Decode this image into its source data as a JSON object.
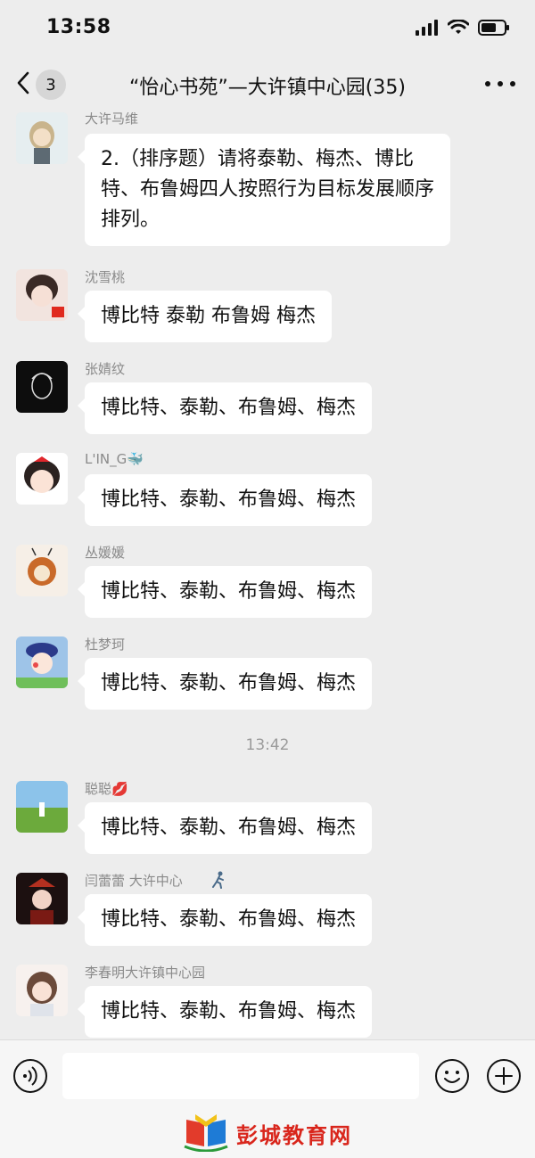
{
  "status_bar": {
    "time": "13:58",
    "icons": [
      "signal-icon",
      "wifi-icon",
      "battery-icon"
    ]
  },
  "nav": {
    "back_badge": "3",
    "title": "“怡心书苑”—大许镇中心园(35)"
  },
  "messages": [
    {
      "sender": "大许马维",
      "text": "2.（排序题）请将泰勒、梅杰、博比特、布鲁姆四人按照行为目标发展顺序排列。"
    },
    {
      "sender": "沈雪桃",
      "text": "博比特 泰勒 布鲁姆 梅杰"
    },
    {
      "sender": "张婧纹",
      "text": "博比特、泰勒、布鲁姆、梅杰"
    },
    {
      "sender": "L'IN_G🐳",
      "text": "博比特、泰勒、布鲁姆、梅杰"
    },
    {
      "sender": "丛媛媛",
      "text": "博比特、泰勒、布鲁姆、梅杰"
    },
    {
      "sender": "杜梦珂",
      "text": "博比特、泰勒、布鲁姆、梅杰"
    },
    {
      "sender": "聪聪💋",
      "text": "博比特、泰勒、布鲁姆、梅杰"
    },
    {
      "sender": "闫蕾蕾 大许中心",
      "text": "博比特、泰勒、布鲁姆、梅杰"
    },
    {
      "sender": "李春明大许镇中心园",
      "text": "博比特、泰勒、布鲁姆、梅杰"
    }
  ],
  "time_divider": "13:42",
  "input_bar": {
    "watermark": "彭城教育网"
  },
  "colors": {
    "background": "#ededed",
    "bubble": "#ffffff",
    "sender_text": "#8a8a8a",
    "watermark": "#d9261c"
  }
}
